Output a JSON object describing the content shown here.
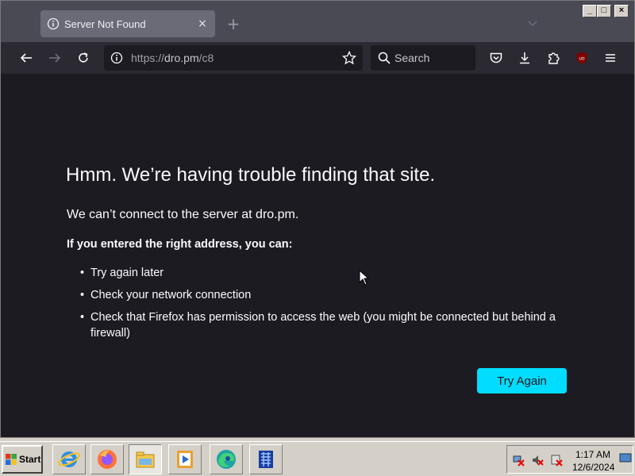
{
  "browser": {
    "tab": {
      "title": "Server Not Found",
      "close_glyph": "×"
    },
    "new_tab_glyph": "+",
    "url": {
      "prefix": "https://",
      "host": "dro.pm",
      "path": "/c8"
    },
    "search_placeholder": "Search",
    "caption": {
      "minimize": "_",
      "maximize": "□",
      "close": "×"
    },
    "toolbar_icons": [
      "back-icon",
      "forward-icon",
      "reload-icon",
      "info-icon",
      "bookmark-star-icon",
      "search-icon",
      "pocket-icon",
      "download-icon",
      "extensions-icon",
      "ublock-icon",
      "menu-icon"
    ]
  },
  "error_page": {
    "title": "Hmm. We’re having trouble finding that site.",
    "subtitle": "We can’t connect to the server at dro.pm.",
    "lead": "If you entered the right address, you can:",
    "items": [
      "Try again later",
      "Check your network connection",
      "Check that Firefox has permission to access the web (you might be connected but behind a firewall)"
    ],
    "button": "Try Again"
  },
  "taskbar": {
    "start_label": "Start",
    "apps": [
      "internet-explorer-icon",
      "firefox-icon",
      "explorer-folder-icon",
      "media-player-icon",
      "edge-icon",
      "network-app-icon"
    ],
    "clock_time": "1:17 AM",
    "clock_date": "12/6/2024"
  },
  "colors": {
    "accent": "#00ddff",
    "page_bg": "#1c1b22",
    "toolbar_bg": "#2b2a33",
    "tabstrip_bg": "#4a4a55"
  }
}
